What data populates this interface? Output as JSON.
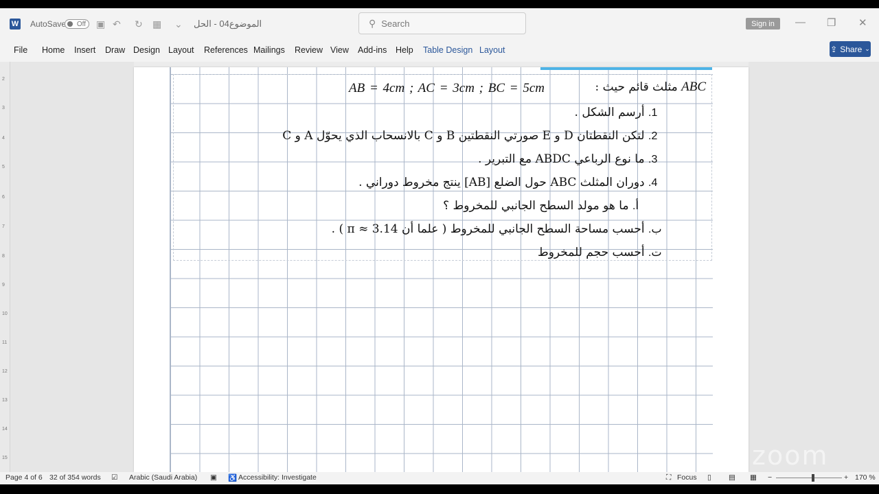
{
  "titlebar": {
    "autosave_label": "AutoSave",
    "autosave_state": "Off",
    "document_title": "الموضوع04 - الحل",
    "search_placeholder": "Search",
    "sign_in": "Sign in"
  },
  "ribbon": {
    "tabs": [
      "File",
      "Home",
      "Insert",
      "Draw",
      "Design",
      "Layout",
      "References",
      "Mailings",
      "Review",
      "View",
      "Add-ins",
      "Help",
      "Table Design",
      "Layout"
    ],
    "share_label": "Share"
  },
  "document": {
    "line0_text": "مثلث قائم حيث :",
    "line0_abc": "ABC",
    "line0_math": "AB = 4cm   ;   AC = 3cm   ;   BC = 5cm",
    "items": [
      {
        "num": "1.",
        "text": "أرسم الشكل ."
      },
      {
        "num": "2.",
        "text": "لتكن النقطتان D و E صورتي النقطتين B و C بالانسحاب الذي يحوّل A و C"
      },
      {
        "num": "3.",
        "text": "ما نوع الرباعي ABDC مع التبرير ."
      },
      {
        "num": "4.",
        "text": "دوران المثلث ABC حول الضلع [AB] ينتج مخروط دوراني ."
      },
      {
        "num": "أ.",
        "text": "ما هو مولد السطح الجانبي للمخروط ؟"
      },
      {
        "num": "ب.",
        "text": "أحسب مساحة السطح الجانبي للمخروط ( علما أن π ≈ 3.14 ) ."
      },
      {
        "num": "ت.",
        "text": "أحسب حجم للمخروط"
      }
    ]
  },
  "status": {
    "page": "Page 4 of 6",
    "words": "32 of 354 words",
    "language": "Arabic (Saudi Arabia)",
    "accessibility": "Accessibility: Investigate",
    "focus": "Focus",
    "zoom": "170 %"
  },
  "watermark": "zoom",
  "colors": {
    "accent": "#2b579a",
    "grid": "#aab6c8",
    "highlight": "#4db3e6"
  }
}
